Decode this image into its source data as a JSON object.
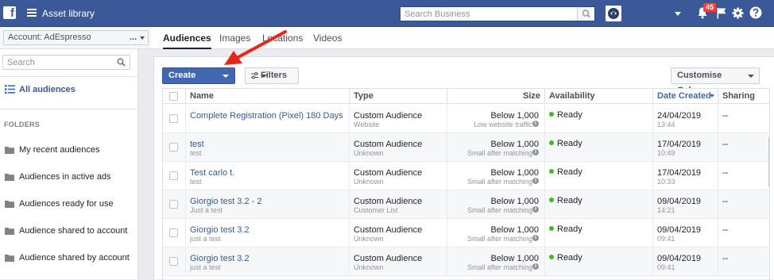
{
  "topbar": {
    "title": "Asset library",
    "search_placeholder": "Search Business",
    "notification_count": "45"
  },
  "sidebar": {
    "account_label": "Account: AdEspresso",
    "account_dots": "...",
    "search_placeholder": "Search",
    "all_audiences": "All audiences",
    "folders_heading": "FOLDERS",
    "folders": [
      "My recent audiences",
      "Audiences in active ads",
      "Audiences ready for use",
      "Audience shared to account",
      "Audience shared by account"
    ]
  },
  "tabs": [
    "Audiences",
    "Images",
    "Locations",
    "Videos"
  ],
  "toolbar": {
    "create_audience": "Create Audience",
    "filters": "Filters",
    "customise_columns": "Customise Columns"
  },
  "table": {
    "columns": {
      "name": "Name",
      "type": "Type",
      "size": "Size",
      "availability": "Availability",
      "date_created": "Date Created",
      "sharing": "Sharing"
    },
    "rows": [
      {
        "name": "Complete Registration (Pixel) 180 Days",
        "desc": "",
        "type": "Custom Audience",
        "subtype": "Website",
        "size": "Below 1,000",
        "size_note": "Low website traffic",
        "availability": "Ready",
        "date": "24/04/2019",
        "time": "13:44",
        "sharing": "--"
      },
      {
        "name": "test",
        "desc": "test",
        "type": "Custom Audience",
        "subtype": "Unknown",
        "size": "Below 1,000",
        "size_note": "Small after matching",
        "availability": "Ready",
        "date": "17/04/2019",
        "time": "10:49",
        "sharing": "--"
      },
      {
        "name": "Test carlo t.",
        "desc": "test",
        "type": "Custom Audience",
        "subtype": "Unknown",
        "size": "Below 1,000",
        "size_note": "Small after matching",
        "availability": "Ready",
        "date": "17/04/2019",
        "time": "10:33",
        "sharing": "--"
      },
      {
        "name": "Giorgio test 3.2 - 2",
        "desc": "Just a test",
        "type": "Custom Audience",
        "subtype": "Customer List",
        "size": "Below 1,000",
        "size_note": "Small after matching",
        "availability": "Ready",
        "date": "09/04/2019",
        "time": "14:21",
        "sharing": "--"
      },
      {
        "name": "Giorgio test 3.2",
        "desc": "just a test",
        "type": "Custom Audience",
        "subtype": "Unknown",
        "size": "Below 1,000",
        "size_note": "Small after matching",
        "availability": "Ready",
        "date": "09/04/2019",
        "time": "09:41",
        "sharing": "--"
      },
      {
        "name": "Giorgio test 3.2",
        "desc": "just a test",
        "type": "Custom Audience",
        "subtype": "Unknown",
        "size": "Below 1,000",
        "size_note": "Small after matching",
        "availability": "Ready",
        "date": "09/04/2019",
        "time": "09:41",
        "sharing": "--"
      }
    ]
  },
  "colors": {
    "brand": "#3b5998",
    "primary_button": "#4267b2",
    "link": "#365899",
    "annotation_arrow": "#e8271c",
    "ready_dot": "#42b72a"
  }
}
